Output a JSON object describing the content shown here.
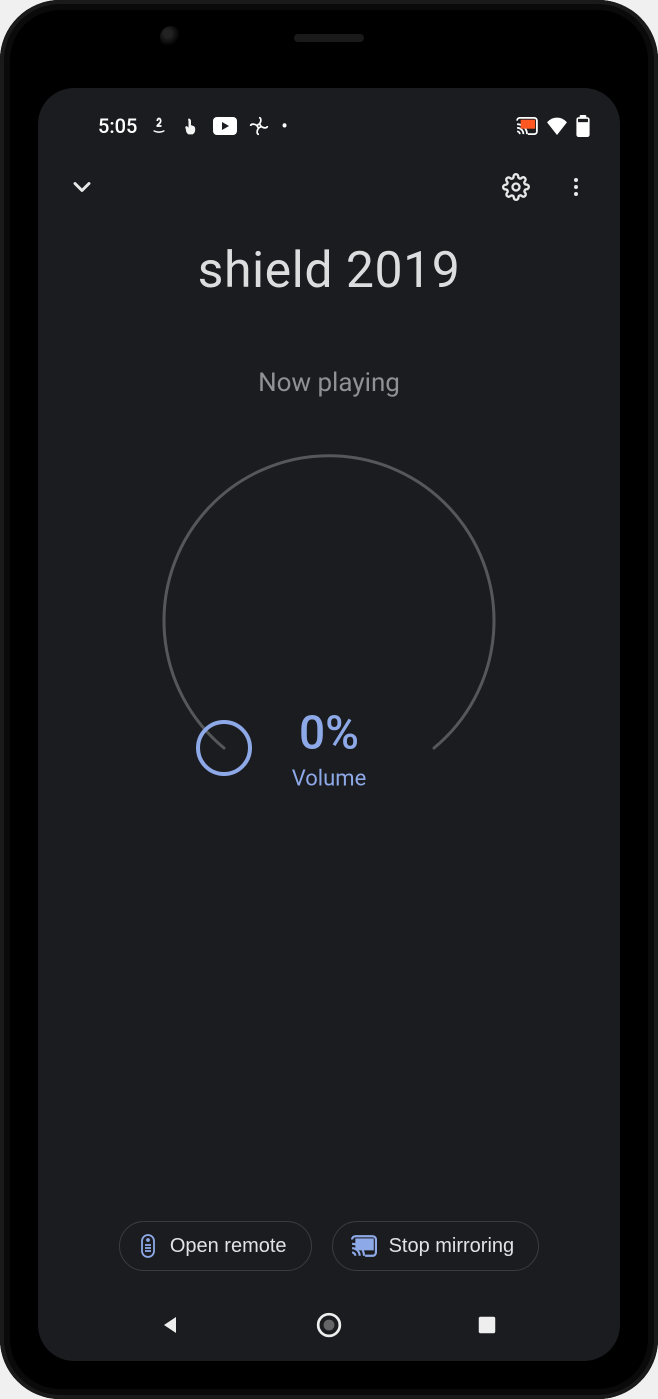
{
  "status_bar": {
    "time": "5:05",
    "notification_dot": "•"
  },
  "app_bar": {
    "collapse_label": "collapse",
    "settings_label": "settings",
    "more_label": "more"
  },
  "device": {
    "name": "shield 2019",
    "status": "Now playing"
  },
  "volume": {
    "percent_text": "0%",
    "label": "Volume",
    "value": 0
  },
  "buttons": {
    "open_remote": "Open remote",
    "stop_mirroring": "Stop mirroring"
  },
  "colors": {
    "accent": "#8ea9e8",
    "bg": "#1b1c20",
    "track": "#55575b"
  }
}
